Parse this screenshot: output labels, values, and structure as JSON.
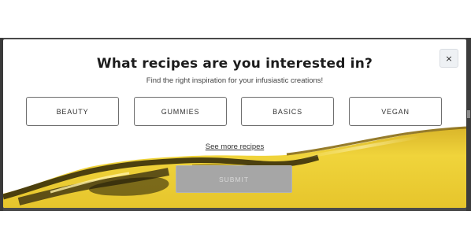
{
  "modal": {
    "close_label": "×",
    "title": "What recipes are you interested in?",
    "subtitle": "Find the right inspiration for your infusiastic creations!",
    "options": [
      {
        "label": "BEAUTY"
      },
      {
        "label": "GUMMIES"
      },
      {
        "label": "BASICS"
      },
      {
        "label": "VEGAN"
      }
    ],
    "see_more_label": "See more recipes",
    "submit_label": "SUBMIT",
    "submit_disabled": true
  },
  "colors": {
    "overlay": "#4a4a4a",
    "oil_gold": "#e9c92e",
    "oil_dark": "#2f2708",
    "submit_bg": "#a6a6a6"
  },
  "icons": {
    "close": "close-icon"
  }
}
